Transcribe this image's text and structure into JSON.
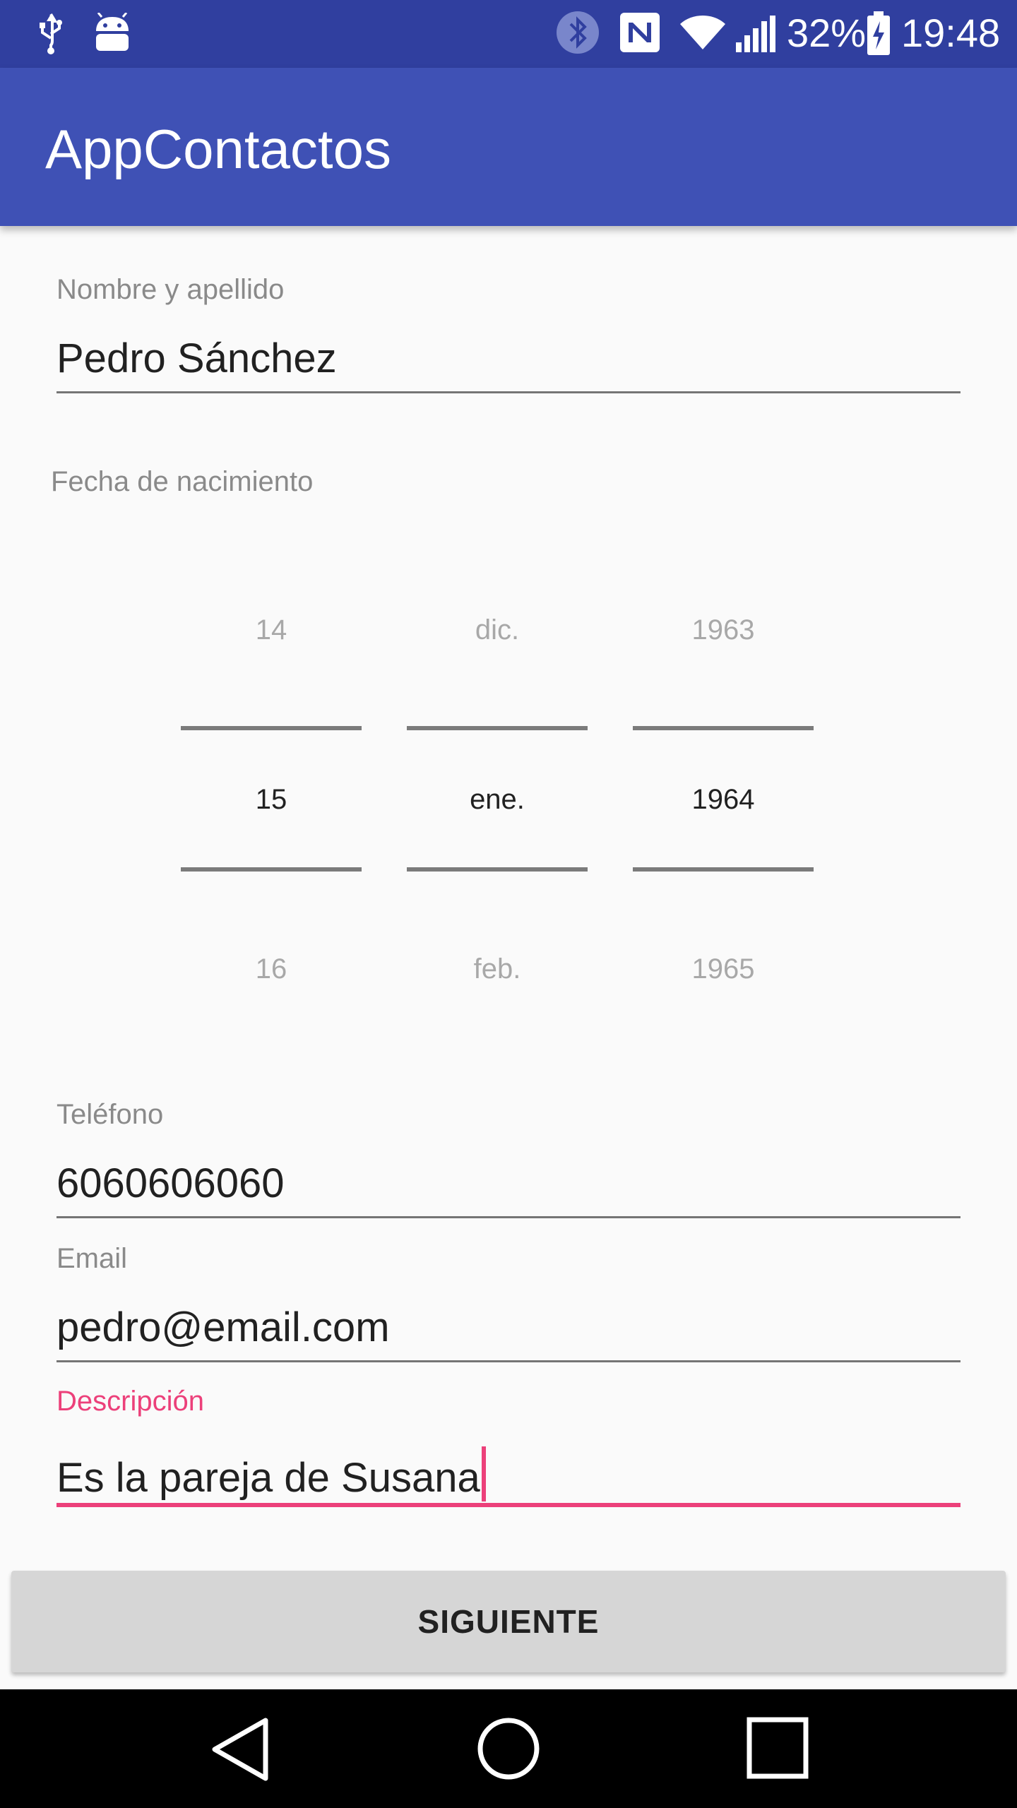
{
  "status_bar": {
    "battery": "32%",
    "time": "19:48",
    "icons": [
      "usb-icon",
      "android-debug-icon",
      "bluetooth-icon",
      "nfc-icon",
      "wifi-icon",
      "signal-icon",
      "battery-charging-icon"
    ]
  },
  "app_bar": {
    "title": "AppContactos"
  },
  "form": {
    "name": {
      "label": "Nombre y apellido",
      "value": "Pedro Sánchez"
    },
    "birth_date": {
      "label": "Fecha de nacimiento",
      "day": {
        "prev": "14",
        "current": "15",
        "next": "16"
      },
      "month": {
        "prev": "dic.",
        "current": "ene.",
        "next": "feb."
      },
      "year": {
        "prev": "1963",
        "current": "1964",
        "next": "1965"
      }
    },
    "phone": {
      "label": "Teléfono",
      "value": "6060606060"
    },
    "email": {
      "label": "Email",
      "value": "pedro@email.com"
    },
    "description": {
      "label": "Descripción",
      "value": "Es la pareja de Susana"
    }
  },
  "actions": {
    "next_label": "SIGUIENTE"
  },
  "colors": {
    "primary": "#3f51b5",
    "primary_dark": "#303f9f",
    "accent": "#ec407a"
  },
  "nav_bar": {
    "buttons": [
      "back-icon",
      "home-icon",
      "recents-icon"
    ]
  }
}
